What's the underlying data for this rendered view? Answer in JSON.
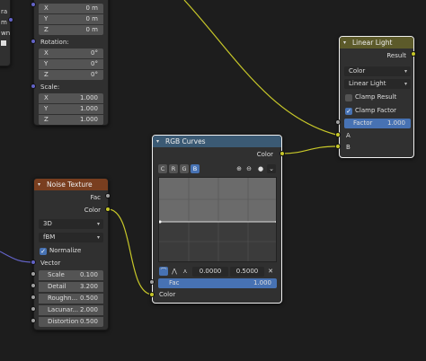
{
  "partial_node": {
    "side_labels": [
      "ra",
      "m",
      "wn"
    ],
    "loc_values": [
      {
        "axis": "X",
        "value": "0 m"
      },
      {
        "axis": "Y",
        "value": "0 m"
      },
      {
        "axis": "Z",
        "value": "0 m"
      }
    ],
    "rotation_label": "Rotation:",
    "rot_values": [
      {
        "axis": "X",
        "value": "0°"
      },
      {
        "axis": "Y",
        "value": "0°"
      },
      {
        "axis": "Z",
        "value": "0°"
      }
    ],
    "scale_label": "Scale:",
    "scale_values": [
      {
        "axis": "X",
        "value": "1.000"
      },
      {
        "axis": "Y",
        "value": "1.000"
      },
      {
        "axis": "Z",
        "value": "1.000"
      }
    ]
  },
  "linear_light": {
    "title": "Linear Light",
    "output": "Result",
    "mode_select": "Color",
    "blend_select": "Linear Light",
    "clamp_result": {
      "label": "Clamp Result",
      "checked": false
    },
    "clamp_factor": {
      "label": "Clamp Factor",
      "checked": true
    },
    "factor": {
      "label": "Factor",
      "value": "1.000"
    },
    "input_a": "A",
    "input_b": "B"
  },
  "rgb_curves": {
    "title": "RGB Curves",
    "output": "Color",
    "channels": [
      "C",
      "R",
      "G",
      "B"
    ],
    "active_channel": "B",
    "point_x": "0.0000",
    "point_y": "0.5000",
    "fac": {
      "label": "Fac",
      "value": "1.000"
    },
    "input_color": "Color"
  },
  "noise_texture": {
    "title": "Noise Texture",
    "outputs": [
      "Fac",
      "Color"
    ],
    "dimension_select": "3D",
    "type_select": "fBM",
    "normalize": {
      "label": "Normalize",
      "checked": true
    },
    "vector_label": "Vector",
    "fields": [
      {
        "label": "Scale",
        "value": "0.100"
      },
      {
        "label": "Detail",
        "value": "3.200"
      },
      {
        "label": "Roughn...",
        "value": "0.500"
      },
      {
        "label": "Lacunar...",
        "value": "2.000"
      },
      {
        "label": "Distortion",
        "value": "0.500"
      }
    ]
  },
  "colors": {
    "canvas": "#1d1d1d",
    "node_body": "#303030",
    "header_color_node": "#3b5a74",
    "header_texture_node": "#793e1f",
    "header_mix_node": "#5c5a2a",
    "accent": "#4772b3",
    "socket_color": "#c7c729",
    "socket_float": "#a1a1a1",
    "socket_vector": "#6363c7"
  }
}
